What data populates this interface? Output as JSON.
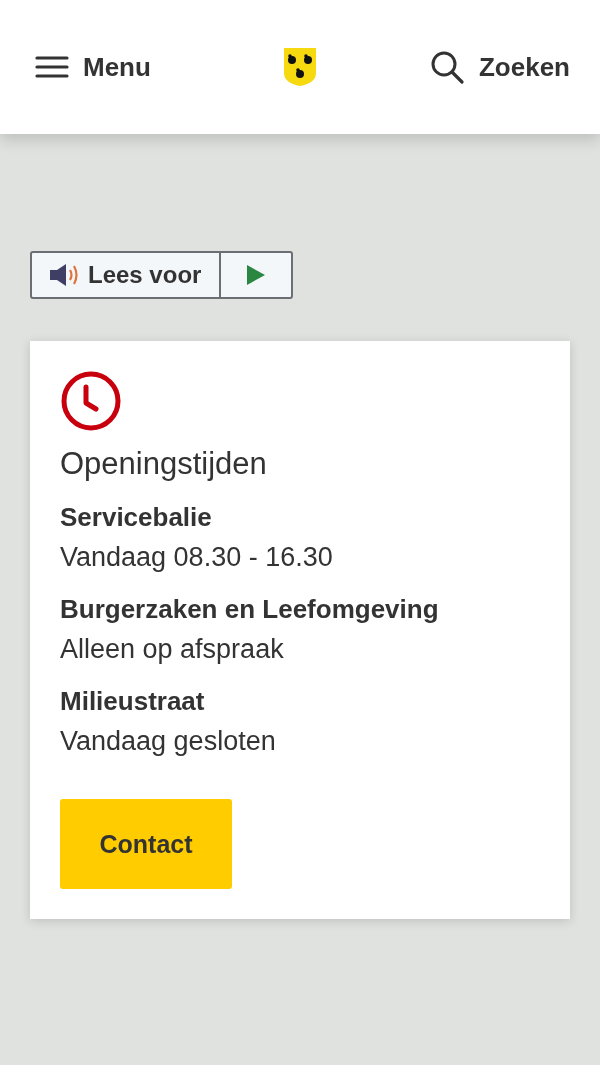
{
  "header": {
    "menu_label": "Menu",
    "search_label": "Zoeken"
  },
  "read_aloud": {
    "label": "Lees voor"
  },
  "card": {
    "title": "Openingstijden",
    "entries": [
      {
        "name": "Servicebalie",
        "hours": "Vandaag 08.30 - 16.30"
      },
      {
        "name": "Burgerzaken en Leefomgeving",
        "hours": "Alleen op afspraak"
      },
      {
        "name": "Milieustraat",
        "hours": "Vandaag gesloten"
      }
    ],
    "button": "Contact"
  }
}
